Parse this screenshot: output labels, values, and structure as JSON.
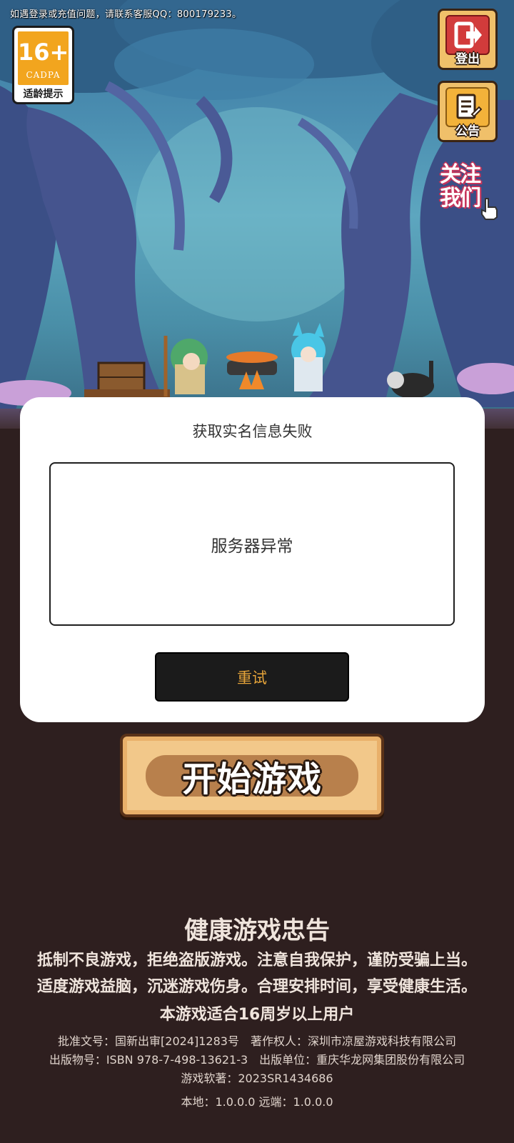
{
  "top_notice": "如遇登录或充值问题，请联系客服QQ：800179233。",
  "age_badge": {
    "number": "16+",
    "org": "CADPA",
    "label": "适龄提示"
  },
  "side_buttons": {
    "logout": {
      "label": "登出",
      "icon": "logout-icon"
    },
    "notice": {
      "label": "公告",
      "icon": "notice-icon"
    },
    "follow": {
      "label": "关注我们",
      "icon": "pointer-hand-icon"
    }
  },
  "dialog": {
    "title": "获取实名信息失败",
    "message": "服务器异常",
    "retry_label": "重试"
  },
  "start_button": {
    "label": "开始游戏"
  },
  "health": {
    "title": "健康游戏忠告",
    "lines": [
      "抵制不良游戏，拒绝盗版游戏。注意自我保护，谨防受骗上当。",
      "适度游戏益脑，沉迷游戏伤身。合理安排时间，享受健康生活。",
      "本游戏适合16周岁以上用户"
    ]
  },
  "info": {
    "lines": [
      "批准文号：国新出审[2024]1283号　著作权人：深圳市凉屋游戏科技有限公司",
      "出版物号：ISBN 978-7-498-13621-3　出版单位：重庆华龙网集团股份有限公司",
      "游戏软著：2023SR1434686",
      "本地：1.0.0.0 远端：1.0.0.0"
    ]
  },
  "colors": {
    "background": "#2e1f1f",
    "retry_text": "#e6a43a",
    "logout_red": "#d23b3b",
    "notice_gold": "#f3b23a"
  }
}
